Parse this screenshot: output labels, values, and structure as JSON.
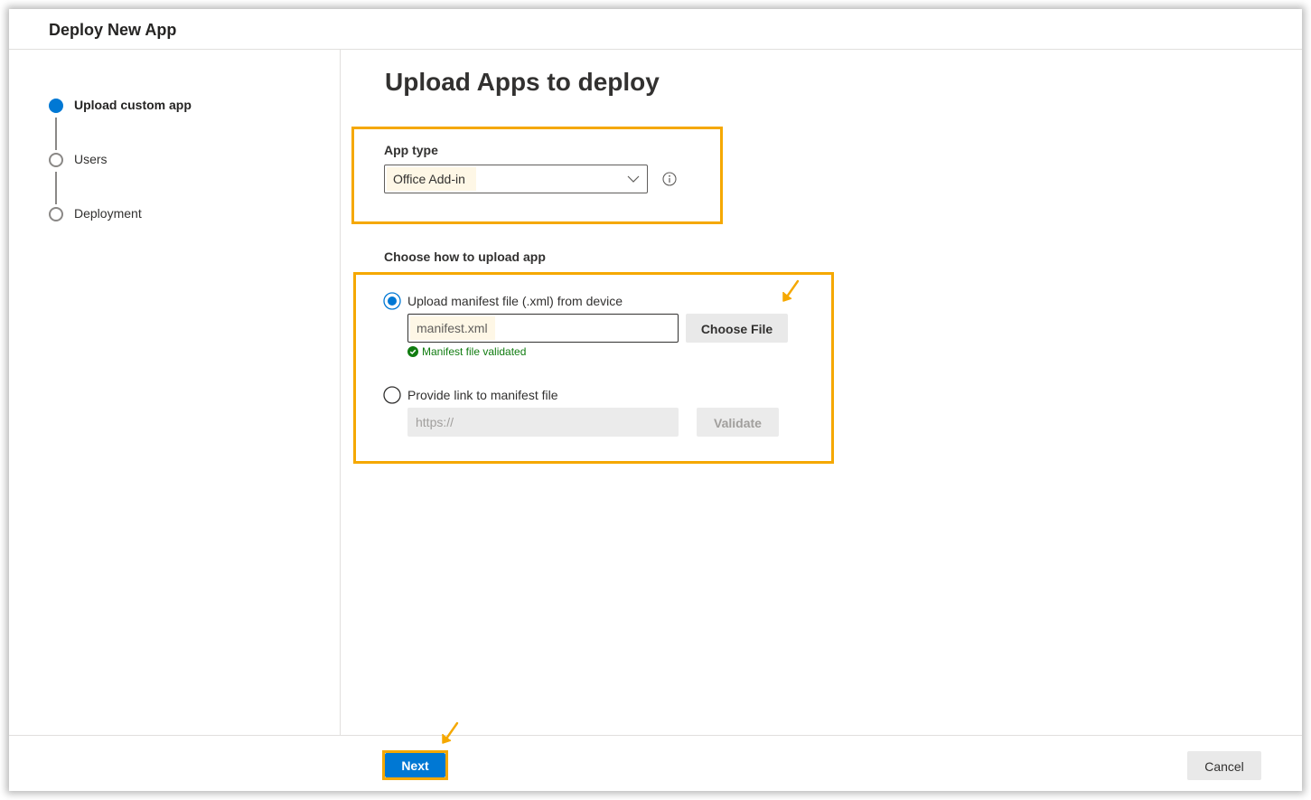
{
  "dialog": {
    "title": "Deploy New App"
  },
  "steps": [
    {
      "label": "Upload custom app",
      "state": "active"
    },
    {
      "label": "Users",
      "state": "pending"
    },
    {
      "label": "Deployment",
      "state": "pending"
    }
  ],
  "main": {
    "title": "Upload Apps to deploy",
    "app_type": {
      "label": "App type",
      "selected": "Office Add-in",
      "info_icon": "info-icon"
    },
    "upload": {
      "label": "Choose how to upload app",
      "options": [
        {
          "label": "Upload manifest file (.xml) from device",
          "selected": true,
          "input_value": "manifest.xml",
          "button_label": "Choose File",
          "status_text": "Manifest file validated",
          "status_icon": "check-circle-icon"
        },
        {
          "label": "Provide link to manifest file",
          "selected": false,
          "input_placeholder": "https://",
          "button_label": "Validate"
        }
      ]
    }
  },
  "footer": {
    "next_label": "Next",
    "cancel_label": "Cancel"
  },
  "colors": {
    "accent": "#0078d4",
    "highlight": "#f5a800",
    "success": "#107c10"
  }
}
